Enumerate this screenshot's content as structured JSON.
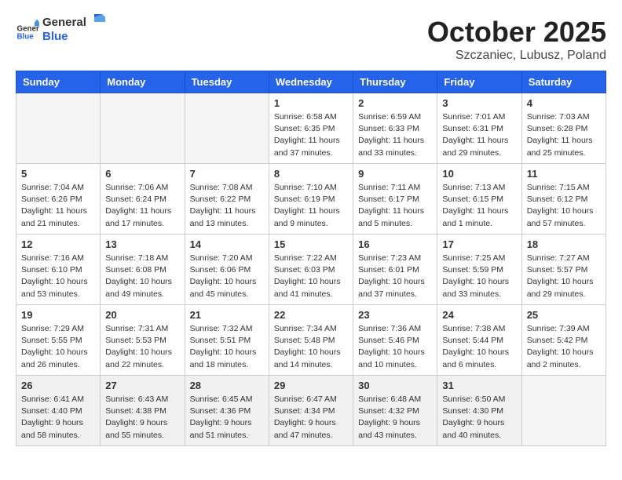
{
  "header": {
    "logo_general": "General",
    "logo_blue": "Blue",
    "month_title": "October 2025",
    "location": "Szczaniec, Lubusz, Poland"
  },
  "weekdays": [
    "Sunday",
    "Monday",
    "Tuesday",
    "Wednesday",
    "Thursday",
    "Friday",
    "Saturday"
  ],
  "weeks": [
    [
      {
        "day": "",
        "info": ""
      },
      {
        "day": "",
        "info": ""
      },
      {
        "day": "",
        "info": ""
      },
      {
        "day": "1",
        "info": "Sunrise: 6:58 AM\nSunset: 6:35 PM\nDaylight: 11 hours\nand 37 minutes."
      },
      {
        "day": "2",
        "info": "Sunrise: 6:59 AM\nSunset: 6:33 PM\nDaylight: 11 hours\nand 33 minutes."
      },
      {
        "day": "3",
        "info": "Sunrise: 7:01 AM\nSunset: 6:31 PM\nDaylight: 11 hours\nand 29 minutes."
      },
      {
        "day": "4",
        "info": "Sunrise: 7:03 AM\nSunset: 6:28 PM\nDaylight: 11 hours\nand 25 minutes."
      }
    ],
    [
      {
        "day": "5",
        "info": "Sunrise: 7:04 AM\nSunset: 6:26 PM\nDaylight: 11 hours\nand 21 minutes."
      },
      {
        "day": "6",
        "info": "Sunrise: 7:06 AM\nSunset: 6:24 PM\nDaylight: 11 hours\nand 17 minutes."
      },
      {
        "day": "7",
        "info": "Sunrise: 7:08 AM\nSunset: 6:22 PM\nDaylight: 11 hours\nand 13 minutes."
      },
      {
        "day": "8",
        "info": "Sunrise: 7:10 AM\nSunset: 6:19 PM\nDaylight: 11 hours\nand 9 minutes."
      },
      {
        "day": "9",
        "info": "Sunrise: 7:11 AM\nSunset: 6:17 PM\nDaylight: 11 hours\nand 5 minutes."
      },
      {
        "day": "10",
        "info": "Sunrise: 7:13 AM\nSunset: 6:15 PM\nDaylight: 11 hours\nand 1 minute."
      },
      {
        "day": "11",
        "info": "Sunrise: 7:15 AM\nSunset: 6:12 PM\nDaylight: 10 hours\nand 57 minutes."
      }
    ],
    [
      {
        "day": "12",
        "info": "Sunrise: 7:16 AM\nSunset: 6:10 PM\nDaylight: 10 hours\nand 53 minutes."
      },
      {
        "day": "13",
        "info": "Sunrise: 7:18 AM\nSunset: 6:08 PM\nDaylight: 10 hours\nand 49 minutes."
      },
      {
        "day": "14",
        "info": "Sunrise: 7:20 AM\nSunset: 6:06 PM\nDaylight: 10 hours\nand 45 minutes."
      },
      {
        "day": "15",
        "info": "Sunrise: 7:22 AM\nSunset: 6:03 PM\nDaylight: 10 hours\nand 41 minutes."
      },
      {
        "day": "16",
        "info": "Sunrise: 7:23 AM\nSunset: 6:01 PM\nDaylight: 10 hours\nand 37 minutes."
      },
      {
        "day": "17",
        "info": "Sunrise: 7:25 AM\nSunset: 5:59 PM\nDaylight: 10 hours\nand 33 minutes."
      },
      {
        "day": "18",
        "info": "Sunrise: 7:27 AM\nSunset: 5:57 PM\nDaylight: 10 hours\nand 29 minutes."
      }
    ],
    [
      {
        "day": "19",
        "info": "Sunrise: 7:29 AM\nSunset: 5:55 PM\nDaylight: 10 hours\nand 26 minutes."
      },
      {
        "day": "20",
        "info": "Sunrise: 7:31 AM\nSunset: 5:53 PM\nDaylight: 10 hours\nand 22 minutes."
      },
      {
        "day": "21",
        "info": "Sunrise: 7:32 AM\nSunset: 5:51 PM\nDaylight: 10 hours\nand 18 minutes."
      },
      {
        "day": "22",
        "info": "Sunrise: 7:34 AM\nSunset: 5:48 PM\nDaylight: 10 hours\nand 14 minutes."
      },
      {
        "day": "23",
        "info": "Sunrise: 7:36 AM\nSunset: 5:46 PM\nDaylight: 10 hours\nand 10 minutes."
      },
      {
        "day": "24",
        "info": "Sunrise: 7:38 AM\nSunset: 5:44 PM\nDaylight: 10 hours\nand 6 minutes."
      },
      {
        "day": "25",
        "info": "Sunrise: 7:39 AM\nSunset: 5:42 PM\nDaylight: 10 hours\nand 2 minutes."
      }
    ],
    [
      {
        "day": "26",
        "info": "Sunrise: 6:41 AM\nSunset: 4:40 PM\nDaylight: 9 hours\nand 58 minutes."
      },
      {
        "day": "27",
        "info": "Sunrise: 6:43 AM\nSunset: 4:38 PM\nDaylight: 9 hours\nand 55 minutes."
      },
      {
        "day": "28",
        "info": "Sunrise: 6:45 AM\nSunset: 4:36 PM\nDaylight: 9 hours\nand 51 minutes."
      },
      {
        "day": "29",
        "info": "Sunrise: 6:47 AM\nSunset: 4:34 PM\nDaylight: 9 hours\nand 47 minutes."
      },
      {
        "day": "30",
        "info": "Sunrise: 6:48 AM\nSunset: 4:32 PM\nDaylight: 9 hours\nand 43 minutes."
      },
      {
        "day": "31",
        "info": "Sunrise: 6:50 AM\nSunset: 4:30 PM\nDaylight: 9 hours\nand 40 minutes."
      },
      {
        "day": "",
        "info": ""
      }
    ]
  ]
}
